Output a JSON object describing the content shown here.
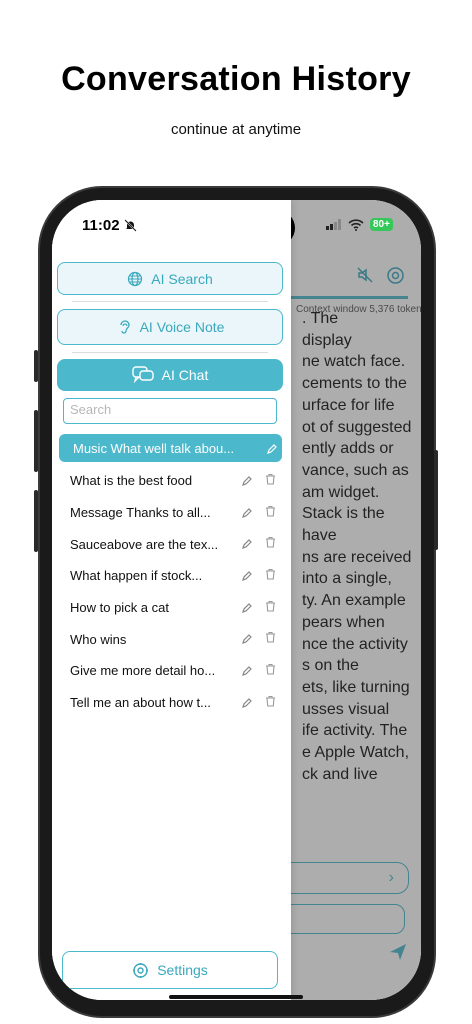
{
  "header": {
    "title": "Conversation History",
    "subtitle": "continue at anytime"
  },
  "status_bar": {
    "time": "11:02",
    "battery": "80+"
  },
  "drawer": {
    "ai_search_label": "AI Search",
    "ai_voice_note_label": "AI Voice Note",
    "ai_chat_label": "AI Chat",
    "search_placeholder": "Search",
    "conversations": [
      "Music What well talk abou...",
      "What is the best food",
      "Message Thanks to all...",
      "Sauceabove are the tex...",
      "What happen if stock...",
      "How to pick a cat",
      "Who wins",
      "Give me more detail ho...",
      "Tell me an about how t..."
    ],
    "settings_label": "Settings"
  },
  "chat": {
    "context_window": "Context window 5,376 token",
    "lines": [
      ". The",
      "display",
      "ne watch face.",
      "cements to the",
      "urface for life",
      "ot of suggested",
      "ently adds or",
      "vance, such as",
      "am widget.",
      "Stack is the",
      "have",
      "ns are received",
      "into a single,",
      "ty. An example",
      "pears when",
      "nce the activity",
      "s on the",
      "ets, like turning",
      "usses visual",
      "ife activity. The",
      "e Apple Watch,",
      "ck and live"
    ]
  },
  "colors": {
    "accent": "#4bb8cc",
    "accent_light": "#eaf6f9"
  }
}
